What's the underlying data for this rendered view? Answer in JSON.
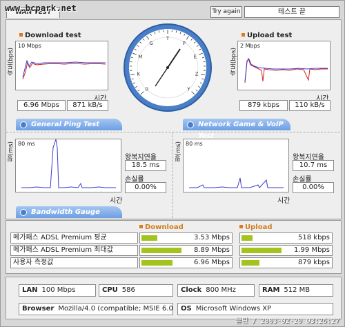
{
  "watermark": "www.bcpark.net",
  "tab_label": "WAN TEST",
  "try_again": "Try again",
  "status": "테스트 끝",
  "download": {
    "title": "Download test",
    "scale": "10 Mbps",
    "y_label": "속도(bps)",
    "x_label": "시간",
    "mbps": "6.96 Mbps",
    "kbs": "871 kB/s"
  },
  "upload": {
    "title": "Upload test",
    "scale": "2 Mbps",
    "y_label": "속도(bps)",
    "x_label": "시간",
    "kbps": "879 kbps",
    "kbs": "110 kB/s"
  },
  "gauge": {
    "ticks": [
      "0",
      "K",
      "M",
      "G",
      "T",
      "P",
      "E",
      "Z",
      "Y"
    ]
  },
  "ping": {
    "banner": "General Ping Test",
    "scale": "80 ms",
    "y_label": "핑(ms)",
    "x_label": "시간",
    "rtt_label": "왕복지연율",
    "rtt": "18.5 ms",
    "loss_label": "손실률",
    "loss": "0.00%"
  },
  "game": {
    "banner": "Network Game & VoIP Test",
    "scale": "80 ms",
    "y_label": "핑(ms)",
    "x_label": "시간",
    "rtt_label": "왕복지연율",
    "rtt": "10.7 ms",
    "loss_label": "손실률",
    "loss": "0.00%"
  },
  "bandwidth": {
    "banner": "Bandwidth Gauge",
    "download_header": "Download",
    "upload_header": "Upload",
    "rows": [
      {
        "label": "메가패스 ADSL Premium 평균",
        "down": "3.53 Mbps",
        "down_frac": 0.4,
        "up": "518 kbps",
        "up_frac": 0.27
      },
      {
        "label": "메가패스 ADSL Premium 최대값",
        "down": "8.89 Mbps",
        "down_frac": 1.0,
        "up": "1.99 Mbps",
        "up_frac": 1.0
      },
      {
        "label": "사용자 측정값",
        "down": "6.96 Mbps",
        "down_frac": 0.78,
        "up": "879 kbps",
        "up_frac": 0.45
      }
    ]
  },
  "system": {
    "lan_label": "LAN",
    "lan": "100 Mbps",
    "cpu_label": "CPU",
    "cpu": "586",
    "clock_label": "Clock",
    "clock": "800 MHz",
    "ram_label": "RAM",
    "ram": "512 MB",
    "browser_label": "Browser",
    "browser": "Mozilla/4.0 (compatible; MSIE 6.0",
    "os_label": "OS",
    "os": "Microsoft Windows XP"
  },
  "footer": "클린 / 2003-02-20 03:26:27",
  "colors": {
    "bar": "#a3c41e",
    "banner": "#6d9ee4",
    "accent": "#e07820",
    "series_blue": "#3a3ad0",
    "series_red": "#d02020"
  }
}
